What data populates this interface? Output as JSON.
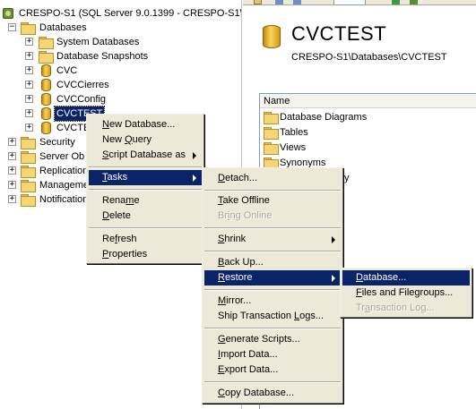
{
  "tree": {
    "server_label": "CRESPO-S1 (SQL Server 9.0.1399 - CRESPO-S1\\a",
    "databases_label": "Databases",
    "system_databases": "System Databases",
    "database_snapshots": "Database Snapshots",
    "db_cvc": "CVC",
    "db_cvccierres": "CVCCierres",
    "db_cvcconfig": "CVCConfig",
    "db_cvctest": "CVCTEST",
    "db_cvctest2": "CVCTE",
    "security": "Security",
    "server_objects": "Server Ob",
    "replication": "Replication",
    "management": "Manageme",
    "notification": "Notification"
  },
  "summary": {
    "title": "CVCTEST",
    "path": "CRESPO-S1\\Databases\\CVCTEST",
    "list_header": "Name",
    "items": [
      "Database Diagrams",
      "Tables",
      "Views",
      "Synonyms",
      "y"
    ]
  },
  "menu1": {
    "new_database_pre": "N",
    "new_database_post": "ew Database...",
    "new_query_pre": "New ",
    "new_query_u": "Q",
    "new_query_post": "uery",
    "script_pre": "",
    "script_u": "S",
    "script_post": "cript Database as",
    "tasks_u": "T",
    "tasks_post": "asks",
    "rename_pre": "Rena",
    "rename_u": "m",
    "rename_post": "e",
    "delete_u": "D",
    "delete_post": "elete",
    "refresh_pre": "Re",
    "refresh_u": "f",
    "refresh_post": "resh",
    "properties_u": "P",
    "properties_post": "roperties"
  },
  "menu2": {
    "detach_u": "D",
    "detach_post": "etach...",
    "take_offline_u": "T",
    "take_offline_post": "ake Offline",
    "bring_online_pre": "Br",
    "bring_online_u": "i",
    "bring_online_post": "ng Online",
    "shrink_u": "S",
    "shrink_post": "hrink",
    "backup_u": "B",
    "backup_post": "ack Up...",
    "restore_u": "R",
    "restore_post": "estore",
    "mirror_u": "M",
    "mirror_post": "irror...",
    "ship_pre": "Ship Transaction ",
    "ship_u": "L",
    "ship_post": "ogs...",
    "generate_u": "G",
    "generate_post": "enerate Scripts...",
    "import_u": "I",
    "import_post": "mport Data...",
    "export_u": "E",
    "export_post": "xport Data...",
    "copy_u": "C",
    "copy_post": "opy Database..."
  },
  "menu3": {
    "database_u": "D",
    "database_post": "atabase...",
    "files_u": "F",
    "files_post": "iles and Filegroups...",
    "tlog_pre": "Tr",
    "tlog_u": "a",
    "tlog_post": "nsaction Log..."
  },
  "colors": {
    "selection": "#0a246a",
    "menu_bg": "#ece9d8",
    "disabled_text": "#aca899",
    "folder": "#f4d676"
  }
}
